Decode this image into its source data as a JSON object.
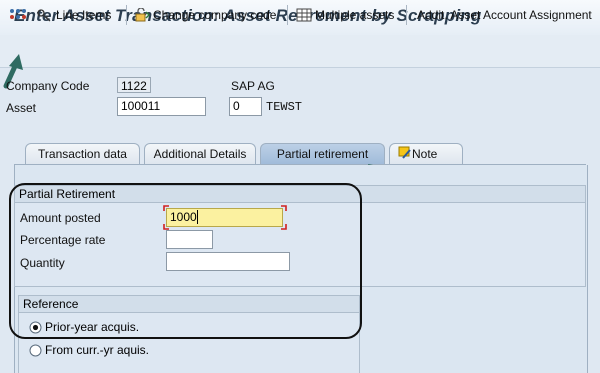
{
  "title": "Enter Asset Transaction: Asset Retirement by Scrapping",
  "toolbar": {
    "line_items": "Line Items",
    "change_company_code": "Change company code",
    "multiple_assets": "Multiple assets",
    "addit_asset_account": "Addit. Asset Account Assignment"
  },
  "header": {
    "company_code_label": "Company Code",
    "company_code_value": "1122",
    "company_name": "SAP AG",
    "asset_label": "Asset",
    "asset_value": "100011",
    "subnumber_value": "0",
    "asset_description": "TEWST"
  },
  "tabs": [
    "Transaction data",
    "Additional Details",
    "Partial retirement",
    "Note"
  ],
  "active_tab": "Partial retirement",
  "partial_retirement": {
    "group_title": "Partial Retirement",
    "amount_posted_label": "Amount posted",
    "amount_posted_value": "1000",
    "percentage_rate_label": "Percentage rate",
    "percentage_rate_value": "",
    "quantity_label": "Quantity",
    "quantity_value": ""
  },
  "reference": {
    "group_title": "Reference",
    "option_prior": "Prior-year acquis.",
    "option_current": "From curr.-yr aquis.",
    "selected": "Prior-year acquis."
  },
  "colors": {
    "arrow": "#2f6b62",
    "highlight_input": "#fbf1a0"
  }
}
